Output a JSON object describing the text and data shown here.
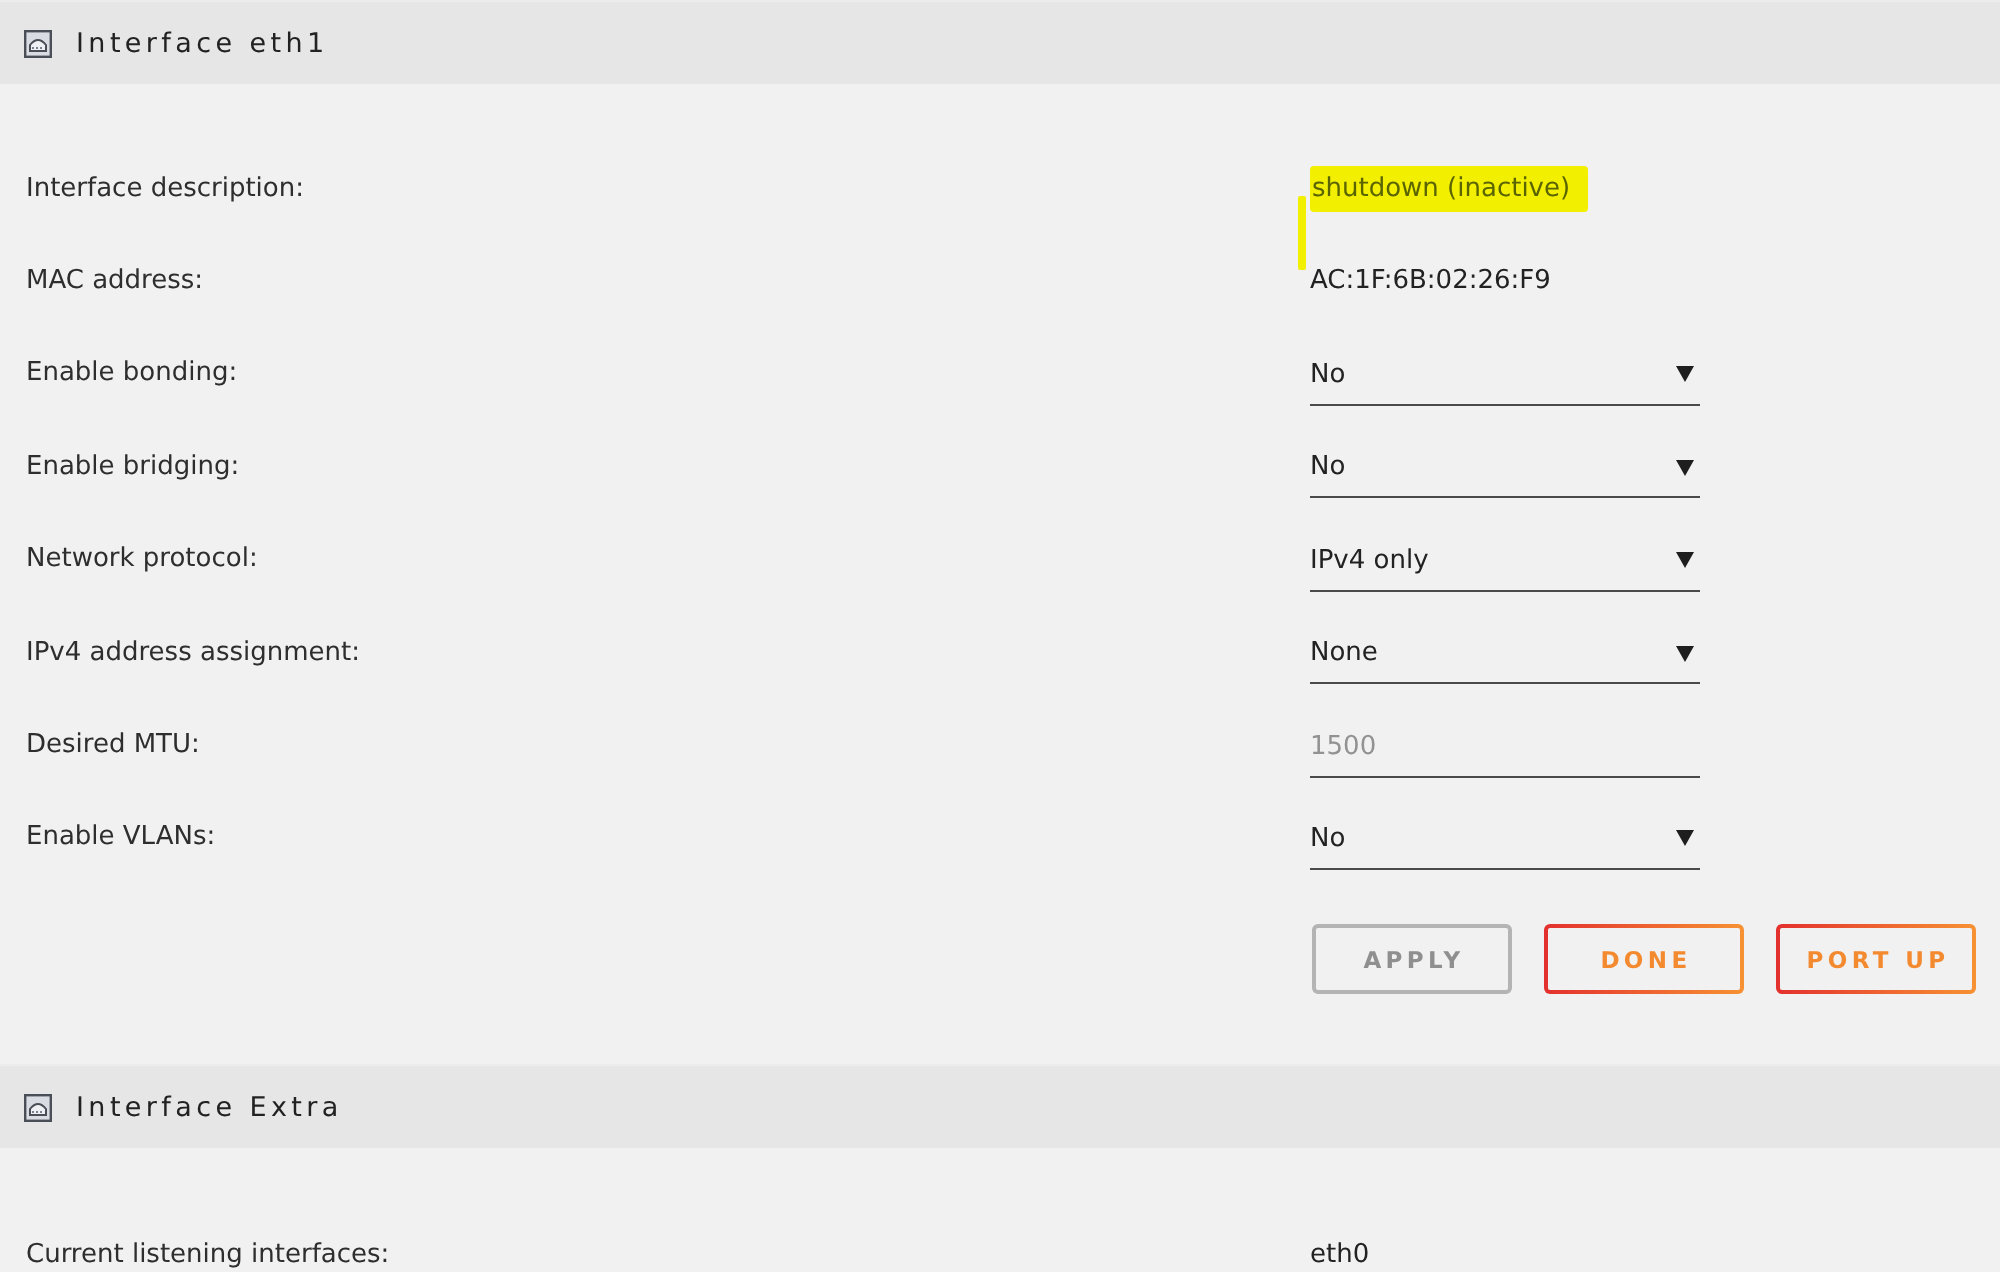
{
  "sections": [
    {
      "title": "Interface eth1",
      "rows": [
        {
          "kind": "text",
          "label": "Interface description:",
          "value": "shutdown (inactive)",
          "highlighted": true
        },
        {
          "kind": "text",
          "label": "MAC address:",
          "value": "AC:1F:6B:02:26:F9",
          "highlighted": false
        },
        {
          "kind": "select",
          "label": "Enable bonding:",
          "value": "No",
          "highlighted": false
        },
        {
          "kind": "select",
          "label": "Enable bridging:",
          "value": "No",
          "highlighted": false
        },
        {
          "kind": "select",
          "label": "Network protocol:",
          "value": "IPv4 only",
          "highlighted": false
        },
        {
          "kind": "select",
          "label": "IPv4 address assignment:",
          "value": "None",
          "highlighted": false
        },
        {
          "kind": "input",
          "label": "Desired MTU:",
          "placeholder": "1500",
          "highlighted": false
        },
        {
          "kind": "select",
          "label": "Enable VLANs:",
          "value": "No",
          "highlighted": false
        }
      ],
      "buttons": [
        {
          "label": "APPLY",
          "disabled": true
        },
        {
          "label": "DONE",
          "disabled": false
        },
        {
          "label": "PORT UP",
          "disabled": false
        }
      ]
    },
    {
      "title": "Interface Extra",
      "rows": [
        {
          "kind": "text",
          "label": "Current listening interfaces:",
          "value": "eth0",
          "highlighted": false
        }
      ]
    }
  ]
}
